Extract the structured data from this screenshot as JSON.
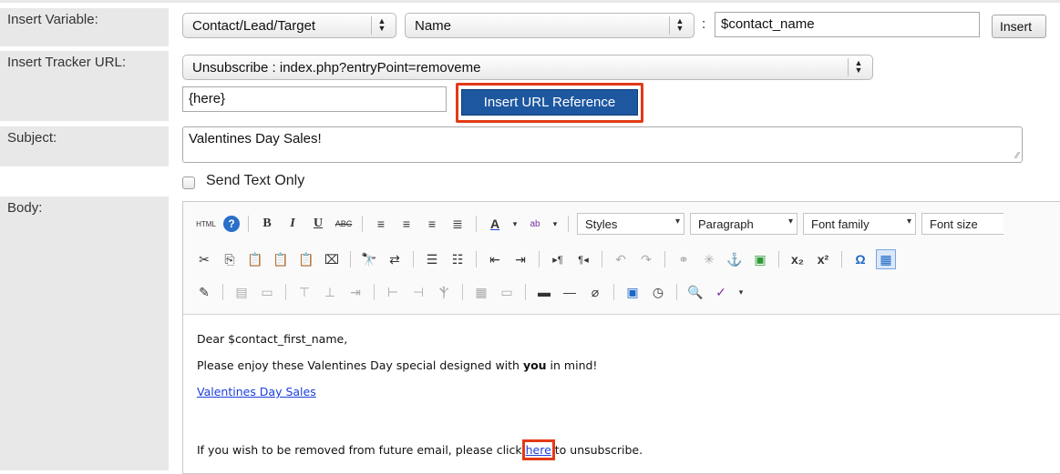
{
  "labels": {
    "insert_variable": "Insert Variable:",
    "insert_tracker_url": "Insert Tracker URL:",
    "subject": "Subject:",
    "body": "Body:"
  },
  "insert_variable": {
    "module_select": "Contact/Lead/Target",
    "field_select": "Name",
    "colon": ":",
    "variable_value": "$contact_name",
    "insert_label": "Insert"
  },
  "tracker_url": {
    "select_value": "Unsubscribe : index.php?entryPoint=removeme",
    "text_value": "{here}",
    "insert_button_label": "Insert URL Reference"
  },
  "subject": {
    "value": "Valentines Day Sales!"
  },
  "send_text_only": {
    "label": "Send Text Only",
    "checked": false
  },
  "toolbar": {
    "styles_label": "Styles",
    "paragraph_label": "Paragraph",
    "font_family_label": "Font family",
    "font_size_label": "Font size"
  },
  "body": {
    "greeting": "Dear $contact_first_name,",
    "line1_before": "Please enjoy these Valentines Day special designed with ",
    "line1_bold": "you",
    "line1_after": " in mind!",
    "link_text": "Valentines Day Sales",
    "line3_before": "If you wish to be removed from future email, please click ",
    "line3_link": "here",
    "line3_after": " to unsubscribe."
  },
  "colors": {
    "highlight": "#e23a16",
    "primary_button": "#1d57a0",
    "link": "#1a3edb"
  }
}
